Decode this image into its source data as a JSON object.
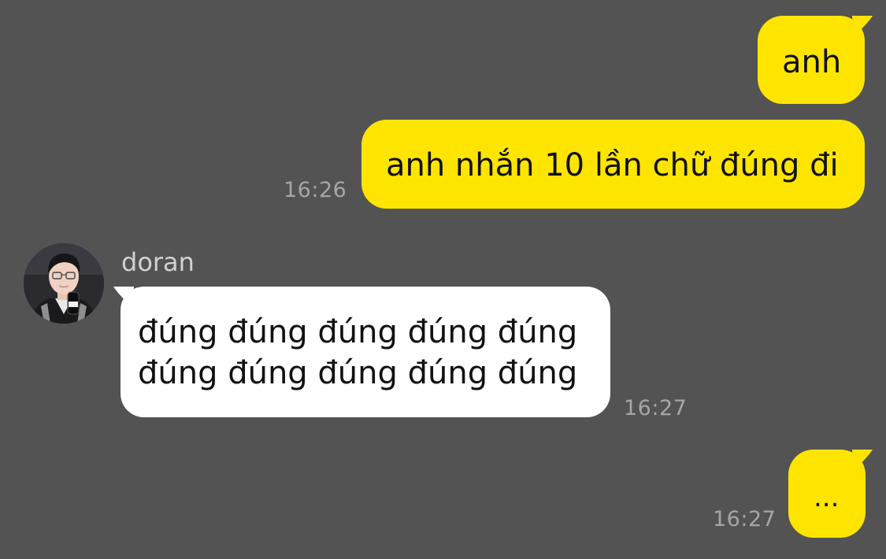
{
  "messages": [
    {
      "id": "m1",
      "from": "me",
      "text": "anh"
    },
    {
      "id": "m2",
      "from": "me",
      "text": "anh nhắn 10 lần chữ đúng đi",
      "time": "16:26"
    },
    {
      "id": "m3",
      "from": "doran",
      "sender_name": "doran",
      "lines": [
        "đúng đúng đúng đúng đúng",
        "đúng đúng đúng đúng đúng"
      ],
      "time": "16:27"
    },
    {
      "id": "m4",
      "from": "me",
      "text": "...",
      "time": "16:27"
    }
  ],
  "icons": {
    "avatar": "profile-photo-avatar"
  },
  "colors": {
    "background": "#545354",
    "outgoing_bubble": "#fee500",
    "incoming_bubble": "#ffffff",
    "timestamp": "#a7a5a7",
    "sender_name": "#d2d0d2"
  }
}
